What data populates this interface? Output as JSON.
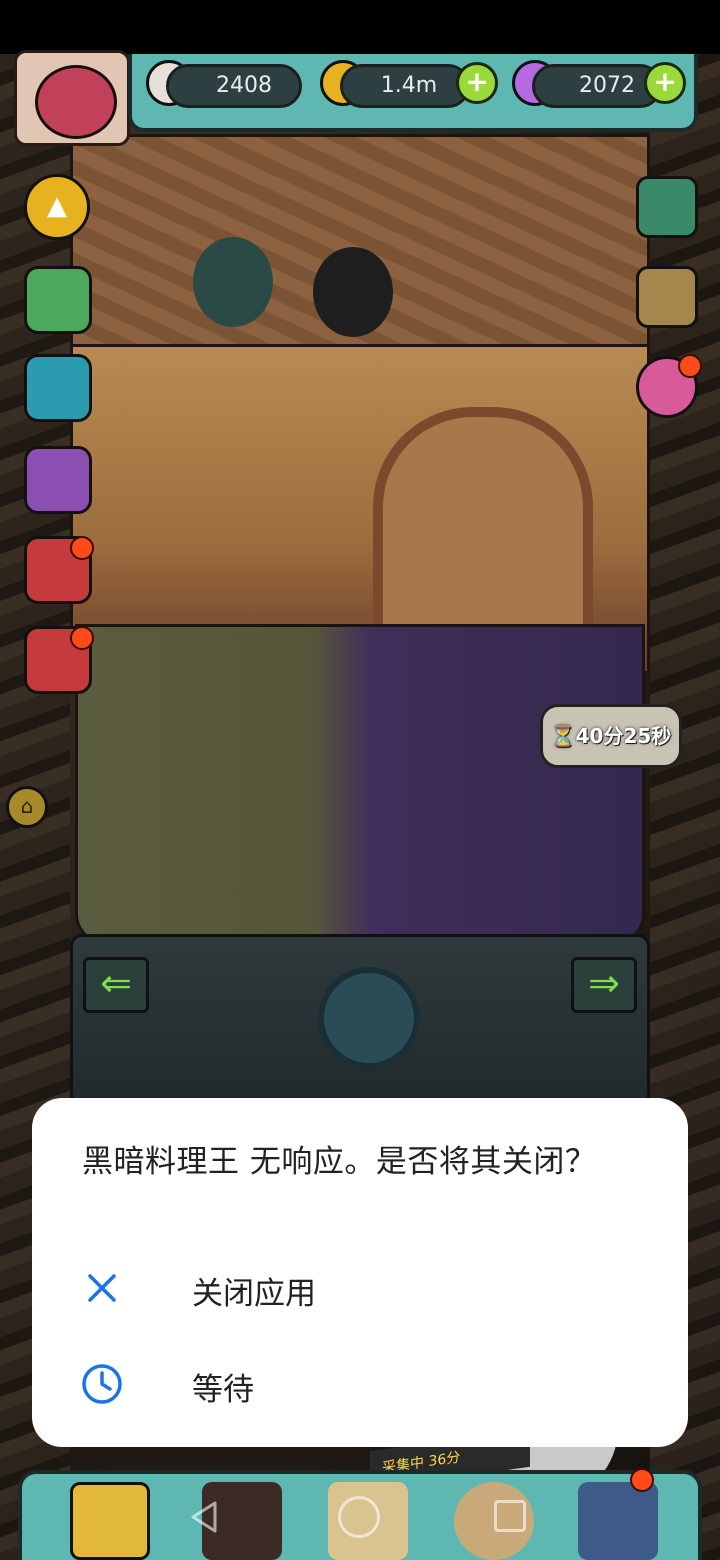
{
  "resources": {
    "eyeballs": {
      "value": "2408",
      "icon": "eyeball-icon"
    },
    "coins": {
      "value": "1.4m",
      "icon": "coin-icon"
    },
    "potions": {
      "value": "2072",
      "icon": "potion-icon"
    }
  },
  "scene": {
    "timer_text": "40分25秒",
    "collect_banner": "采集中  36分"
  },
  "dialog": {
    "title": "黑暗料理王 无响应。是否将其关闭？",
    "options": [
      {
        "label": "关闭应用",
        "icon": "close-icon"
      },
      {
        "label": "等待",
        "icon": "clock-icon"
      }
    ]
  },
  "colors": {
    "accent_blue": "#1a73e8",
    "teal_frame": "#5fb7b2",
    "plus_green": "#9bd83a"
  }
}
